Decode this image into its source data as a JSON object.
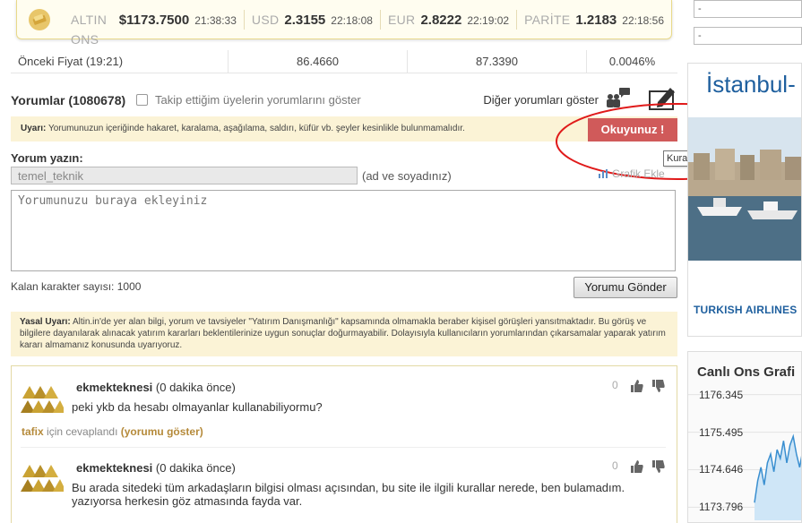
{
  "ticker": {
    "items": [
      {
        "name": "ALTIN ONS",
        "value": "$1173.7500",
        "time": "21:38:33"
      },
      {
        "name": "USD",
        "value": "2.3155",
        "time": "22:18:08"
      },
      {
        "name": "EUR",
        "value": "2.8222",
        "time": "22:19:02"
      },
      {
        "name": "PARİTE",
        "value": "1.2183",
        "time": "22:18:56"
      }
    ]
  },
  "previous_price": {
    "label": "Önceki Fiyat (19:21)",
    "values": [
      "86.4660",
      "87.3390",
      "0.0046%"
    ]
  },
  "comments_header": {
    "title": "Yorumlar (1080678)",
    "follow_label": "Takip ettiğim üyelerin yorumlarını göster",
    "other_label": "Diğer yorumları göster"
  },
  "warning": {
    "prefix": "Uyarı:",
    "text": "Yorumunuzun içeriğinde hakaret, karalama, aşağılama, saldırı, küfür vb. şeyler kesinlikle bulunmamalıdır.",
    "button": "Okuyunuz !",
    "tooltip": "Kuralların tamamını göster"
  },
  "form": {
    "label": "Yorum yazın:",
    "name_value": "temel_teknik",
    "name_hint": "(ad ve soyadınız)",
    "grafik_label": "Grafik Ekle",
    "placeholder": "Yorumunuzu buraya ekleyiniz",
    "remaining": "Kalan karakter sayısı: 1000",
    "send": "Yorumu Gönder"
  },
  "legal": {
    "prefix": "Yasal Uyarı:",
    "text": "Altin.in'de yer alan bilgi, yorum ve tavsiyeler \"Yatırım Danışmanlığı\" kapsamında olmamakla beraber kişisel görüşleri yansıtmaktadır. Bu görüş ve bilgilere dayanılarak alınacak yatırım kararları beklentilerinize uygun sonuçlar doğurmayabilir. Dolayısıyla kullanıcıların yorumlarından çıkarsamalar yaparak yatırım kararı almamanız konusunda uyarıyoruz."
  },
  "comments": [
    {
      "user": "ekmekteknesi",
      "time": "(0 dakika önce)",
      "count": "0",
      "body": "peki ykb da hesabı olmayanlar kullanabiliyormu?",
      "reply_user": "tafix",
      "reply_text": "için cevaplandı",
      "reply_link": "(yorumu göster)"
    },
    {
      "user": "ekmekteknesi",
      "time": "(0 dakika önce)",
      "count": "0",
      "body": "Bu arada sitedeki tüm arkadaşların bilgisi olması açısından, bu site ile ilgili kurallar nerede, ben bulamadım. yazıyorsa herkesin göz atmasında fayda var."
    }
  ],
  "sidebar": {
    "selects": [
      "-",
      "-"
    ],
    "ad_title": "İstanbul-",
    "ad_brand": "TURKISH AIRLINES",
    "chart_title": "Canlı Ons Grafiği"
  },
  "chart_data": {
    "type": "line",
    "title": "Canlı Ons Grafi",
    "y_ticks": [
      "1176.345",
      "1175.495",
      "1174.646",
      "1173.796"
    ],
    "ylim": [
      1173.5,
      1176.5
    ],
    "values": [
      1173.9,
      1174.4,
      1174.7,
      1174.3,
      1174.8,
      1175.0,
      1174.6,
      1175.1,
      1174.9,
      1175.3,
      1174.8,
      1175.2,
      1175.4,
      1175.0,
      1174.7,
      1175.1
    ]
  },
  "colors": {
    "accent_red": "#d05a5a",
    "warning_bg": "#fbf3d6",
    "airline_blue": "#1e5f9e",
    "reply_gold": "#b58a3a"
  }
}
